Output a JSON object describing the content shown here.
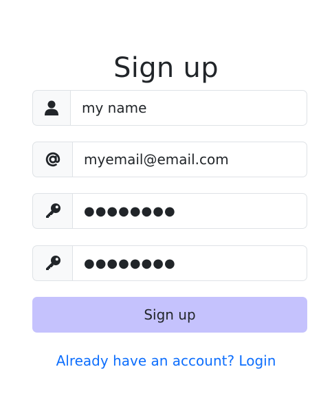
{
  "page": {
    "title": "Sign up"
  },
  "form": {
    "name_field": {
      "icon": "user-icon",
      "value": "my name"
    },
    "email_field": {
      "icon": "at-sign-icon",
      "value": "myemail@email.com"
    },
    "password_field": {
      "icon": "key-icon",
      "value": "●●●●●●●●"
    },
    "confirm_password_field": {
      "icon": "key-icon",
      "value": "●●●●●●●●"
    },
    "submit_label": "Sign up"
  },
  "footer": {
    "login_link": "Already have an account? Login"
  },
  "colors": {
    "primary_button": "#c5c2fd",
    "link": "#0d6efd",
    "addon_background": "#f8f9fa",
    "border": "#dee2e6",
    "text": "#212529"
  }
}
